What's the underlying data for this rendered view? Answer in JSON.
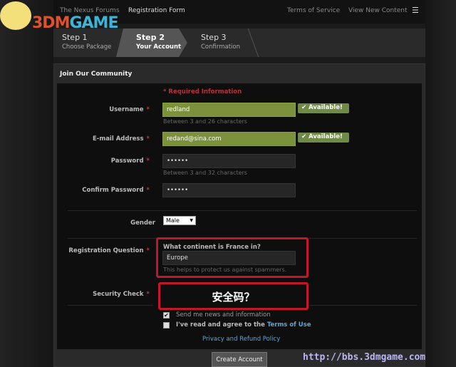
{
  "nav": {
    "forums": "The Nexus Forums",
    "current": "Registration Form",
    "terms": "Terms of Service",
    "new_content": "View New Content",
    "menu_icon": "list-icon"
  },
  "steps": [
    {
      "title": "Step 1",
      "sub": "Choose Package"
    },
    {
      "title": "Step 2",
      "sub": "Your Account"
    },
    {
      "title": "Step 3",
      "sub": "Confirmation"
    }
  ],
  "panel": {
    "title": "Join Our Community"
  },
  "form": {
    "required": "* Required Information",
    "username": {
      "label": "Username",
      "value": "redland",
      "hint": "Between 3 and 26 characters",
      "status": "✔ Available!"
    },
    "email": {
      "label": "E-mail Address",
      "value": "redand@sina.com",
      "status": "✔ Available!"
    },
    "password": {
      "label": "Password",
      "value": "••••••",
      "hint": "Between 3 and 32 characters"
    },
    "confirm": {
      "label": "Confirm Password",
      "value": "••••••"
    },
    "gender": {
      "label": "Gender",
      "value": "Male"
    },
    "question": {
      "label": "Registration Question",
      "question": "What continent is France in?",
      "value": "Europe",
      "hint": "This helps to protect us against spammers."
    },
    "security": {
      "label": "Security Check",
      "annotation": "安全码？"
    },
    "news": {
      "label": "Send me news and information",
      "checked": true
    },
    "agree": {
      "label": "I've read and agree to the ",
      "link": "Terms of Use",
      "checked": false
    },
    "privacy": "Privacy and Refund Policy",
    "submit": "Create Account"
  },
  "watermark": {
    "logo": "3DMGAME",
    "url": "http://bbs.3dmgame.com"
  },
  "colors": {
    "accent_green": "#7c913c",
    "required_red": "#c33",
    "link_blue": "#5aa6d8",
    "annotation_red": "#c0182a"
  }
}
